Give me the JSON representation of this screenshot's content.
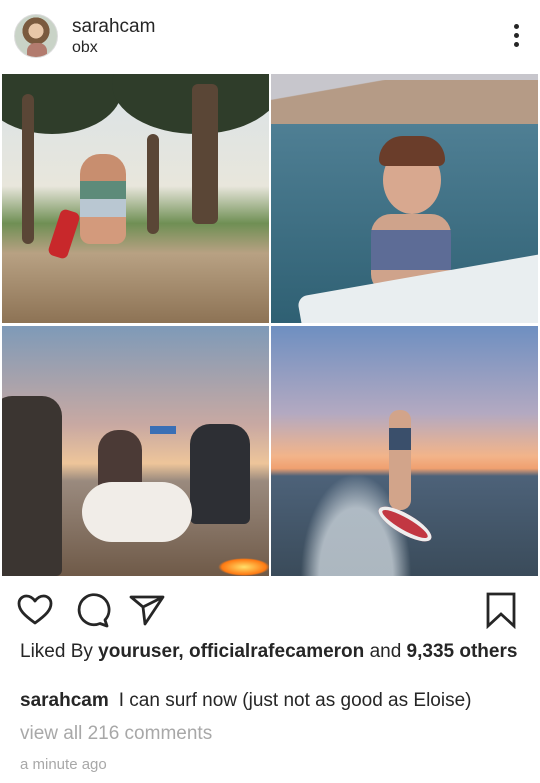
{
  "post": {
    "username": "sarahcam",
    "location": "obx",
    "likes": {
      "prefix": "Liked By",
      "user1": "youruser,",
      "user2": "officialrafecameron",
      "connector": "and",
      "count": "9,335",
      "suffix": "others"
    },
    "caption": {
      "username": "sarahcam",
      "text": "I can surf now (just not as good as Eloise)"
    },
    "view_comments": "view all 216 comments",
    "timestamp": "a minute ago"
  },
  "icons": {
    "more": "more-options-icon",
    "like": "heart-icon",
    "comment": "comment-icon",
    "share": "paper-plane-icon",
    "save": "bookmark-icon"
  },
  "colors": {
    "text": "#262626",
    "muted": "#a8a8a8",
    "background": "#ffffff"
  }
}
